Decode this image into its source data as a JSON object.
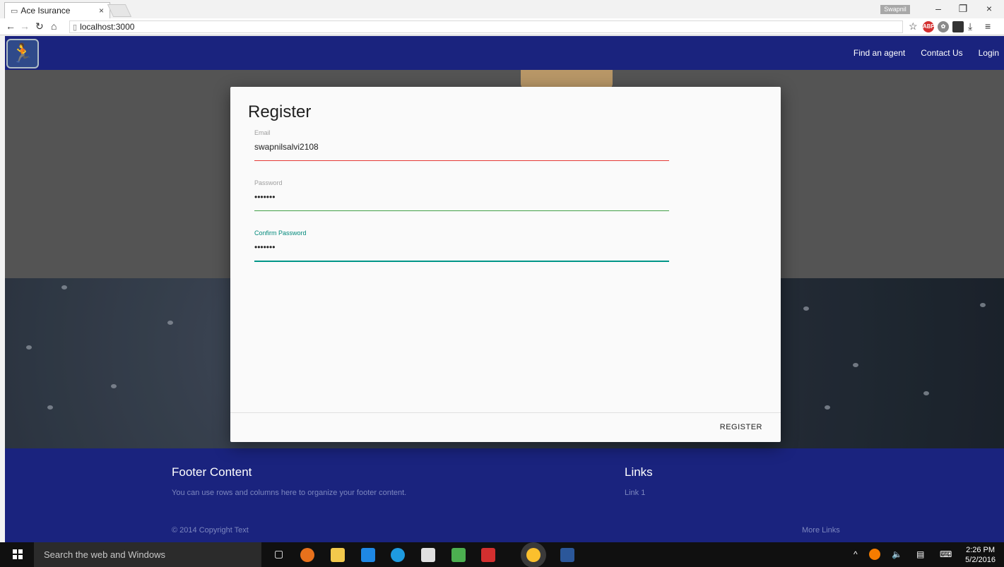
{
  "browser": {
    "tab_title": "Ace Isurance",
    "tab_close": "×",
    "profile_name": "Swapnil",
    "url": "localhost:3000",
    "window_minimize": "–",
    "window_restore": "❐",
    "window_close": "×"
  },
  "navbar": {
    "links": [
      "Find an agent",
      "Contact Us",
      "Login"
    ]
  },
  "register_dialog": {
    "title": "Register",
    "email_label": "Email",
    "email_value": "swapnilsalvi2108",
    "password_label": "Password",
    "password_value": "•••••••",
    "confirm_label": "Confirm Password",
    "confirm_value": "•••••••",
    "submit_label": "REGISTER",
    "colors": {
      "email_underline": "#e53935",
      "password_underline": "#43a047",
      "confirm_underline": "#009688",
      "confirm_label": "#00897b"
    }
  },
  "footer": {
    "title": "Footer Content",
    "text": "You can use rows and columns here to organize your footer content.",
    "links_title": "Links",
    "link1": "Link 1",
    "copyright": "© 2014 Copyright Text",
    "more_links": "More Links"
  },
  "taskbar": {
    "search_placeholder": "Search the web and Windows",
    "time": "2:26 PM",
    "date": "5/2/2016"
  },
  "colors": {
    "navbar": "#1a237e",
    "footer": "#1a237e"
  }
}
